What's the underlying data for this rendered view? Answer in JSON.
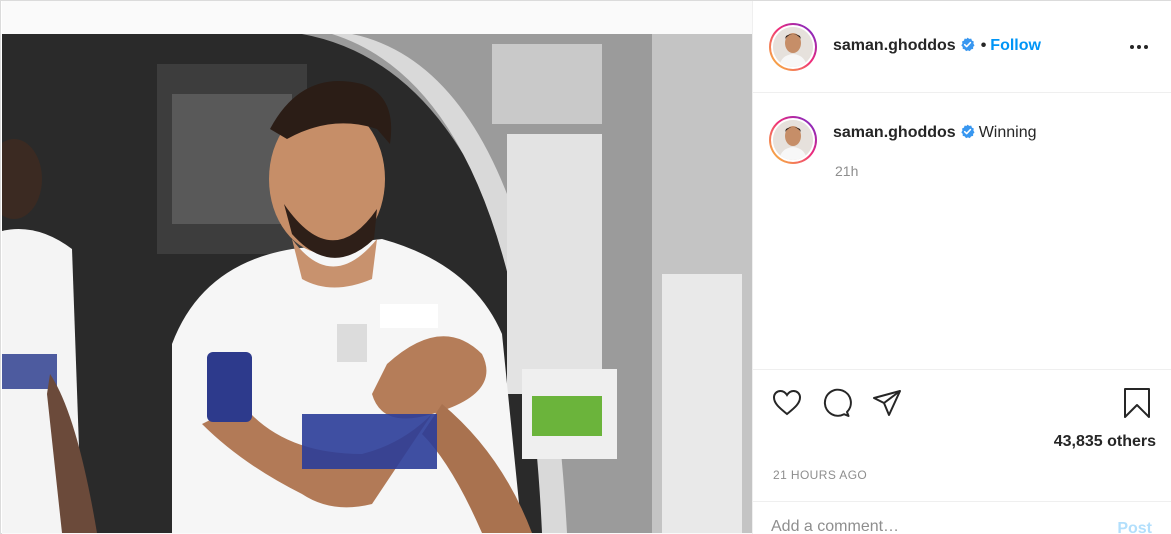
{
  "post": {
    "photo_alt": ""
  },
  "header": {
    "username": "saman.ghoddos",
    "separator": "•",
    "follow_label": "Follow",
    "more_icon": "more-horizontal-icon"
  },
  "caption": {
    "username": "saman.ghoddos",
    "text": "Winning",
    "time": "21h"
  },
  "actions": {
    "icons": [
      "heart-icon",
      "comment-icon",
      "share-icon",
      "bookmark-icon"
    ],
    "likes_text": "43,835 others"
  },
  "meta": {
    "posted": "21 HOURS AGO"
  },
  "comment": {
    "placeholder": "Add a comment…",
    "post_label": "Post"
  },
  "colors": {
    "accent": "#0095f6",
    "verified": "#3897f0",
    "muted": "#8e8e8e"
  }
}
